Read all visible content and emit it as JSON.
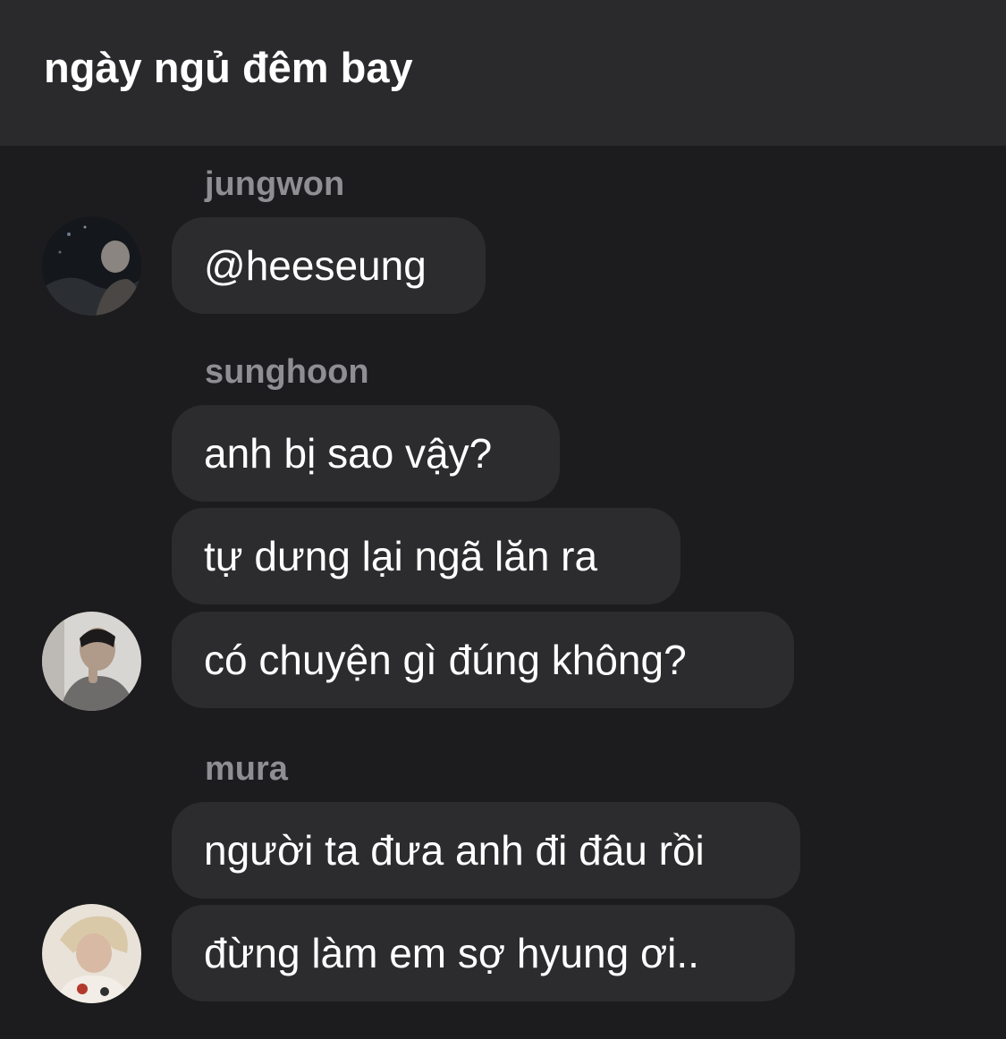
{
  "header": {
    "title": "ngày ngủ đêm bay"
  },
  "messages": [
    {
      "sender": "jungwon",
      "avatar": "jungwon-avatar",
      "lines": [
        "@heeseung"
      ]
    },
    {
      "sender": "sunghoon",
      "avatar": "sunghoon-avatar",
      "lines": [
        "anh bị sao vậy?",
        "tự dưng lại ngã lăn ra",
        "có chuyện gì đúng không?"
      ]
    },
    {
      "sender": "mura",
      "avatar": "mura-avatar",
      "lines": [
        "người ta đưa anh đi đâu rồi",
        "đừng làm em sợ hyung ơi.."
      ]
    }
  ],
  "colors": {
    "header_bg": "#2a2a2c",
    "chat_bg": "#1c1c1e",
    "bubble_bg": "#2c2c2e",
    "sender_name": "#8e8e93",
    "text": "#ffffff"
  }
}
